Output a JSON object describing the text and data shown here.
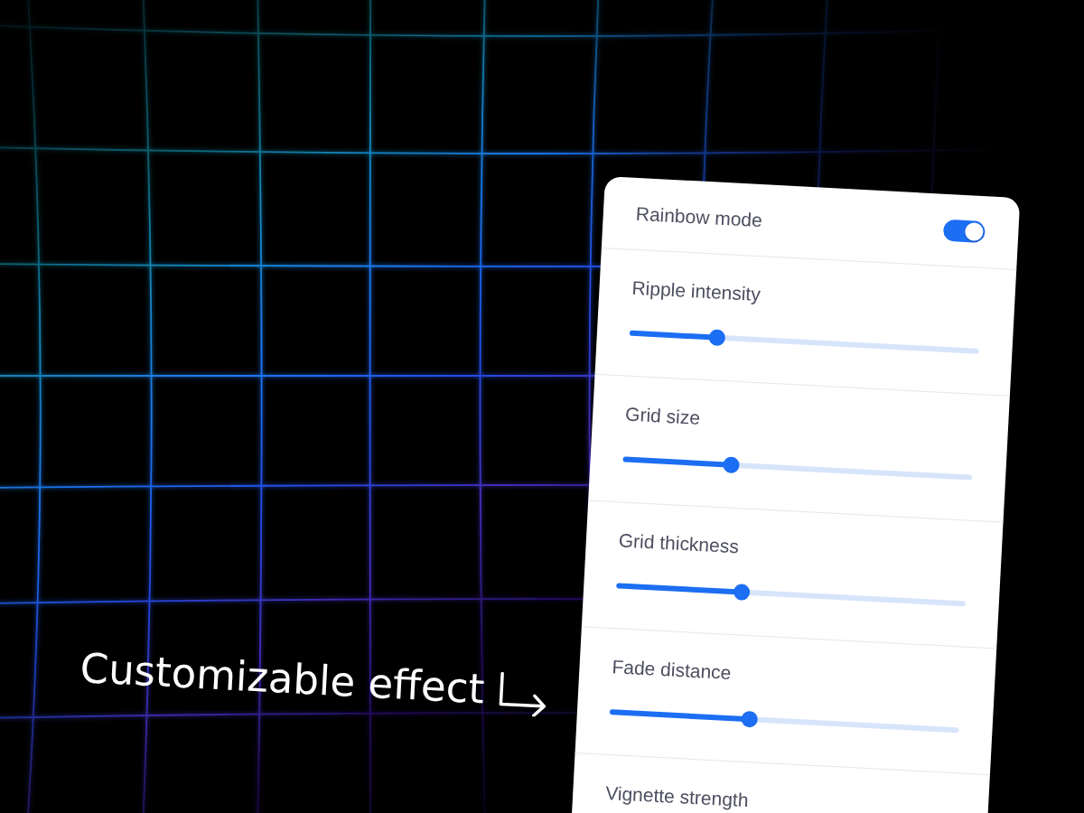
{
  "caption": "Customizable effect",
  "settings": [
    {
      "kind": "toggle",
      "label": "Rainbow mode",
      "on": true
    },
    {
      "kind": "slider",
      "label": "Ripple intensity",
      "level": 0.25
    },
    {
      "kind": "slider",
      "label": "Grid size",
      "level": 0.31
    },
    {
      "kind": "slider",
      "label": "Grid thickness",
      "level": 0.36
    },
    {
      "kind": "slider",
      "label": "Fade distance",
      "level": 0.4
    },
    {
      "kind": "slider",
      "label": "Vignette strength"
    }
  ]
}
